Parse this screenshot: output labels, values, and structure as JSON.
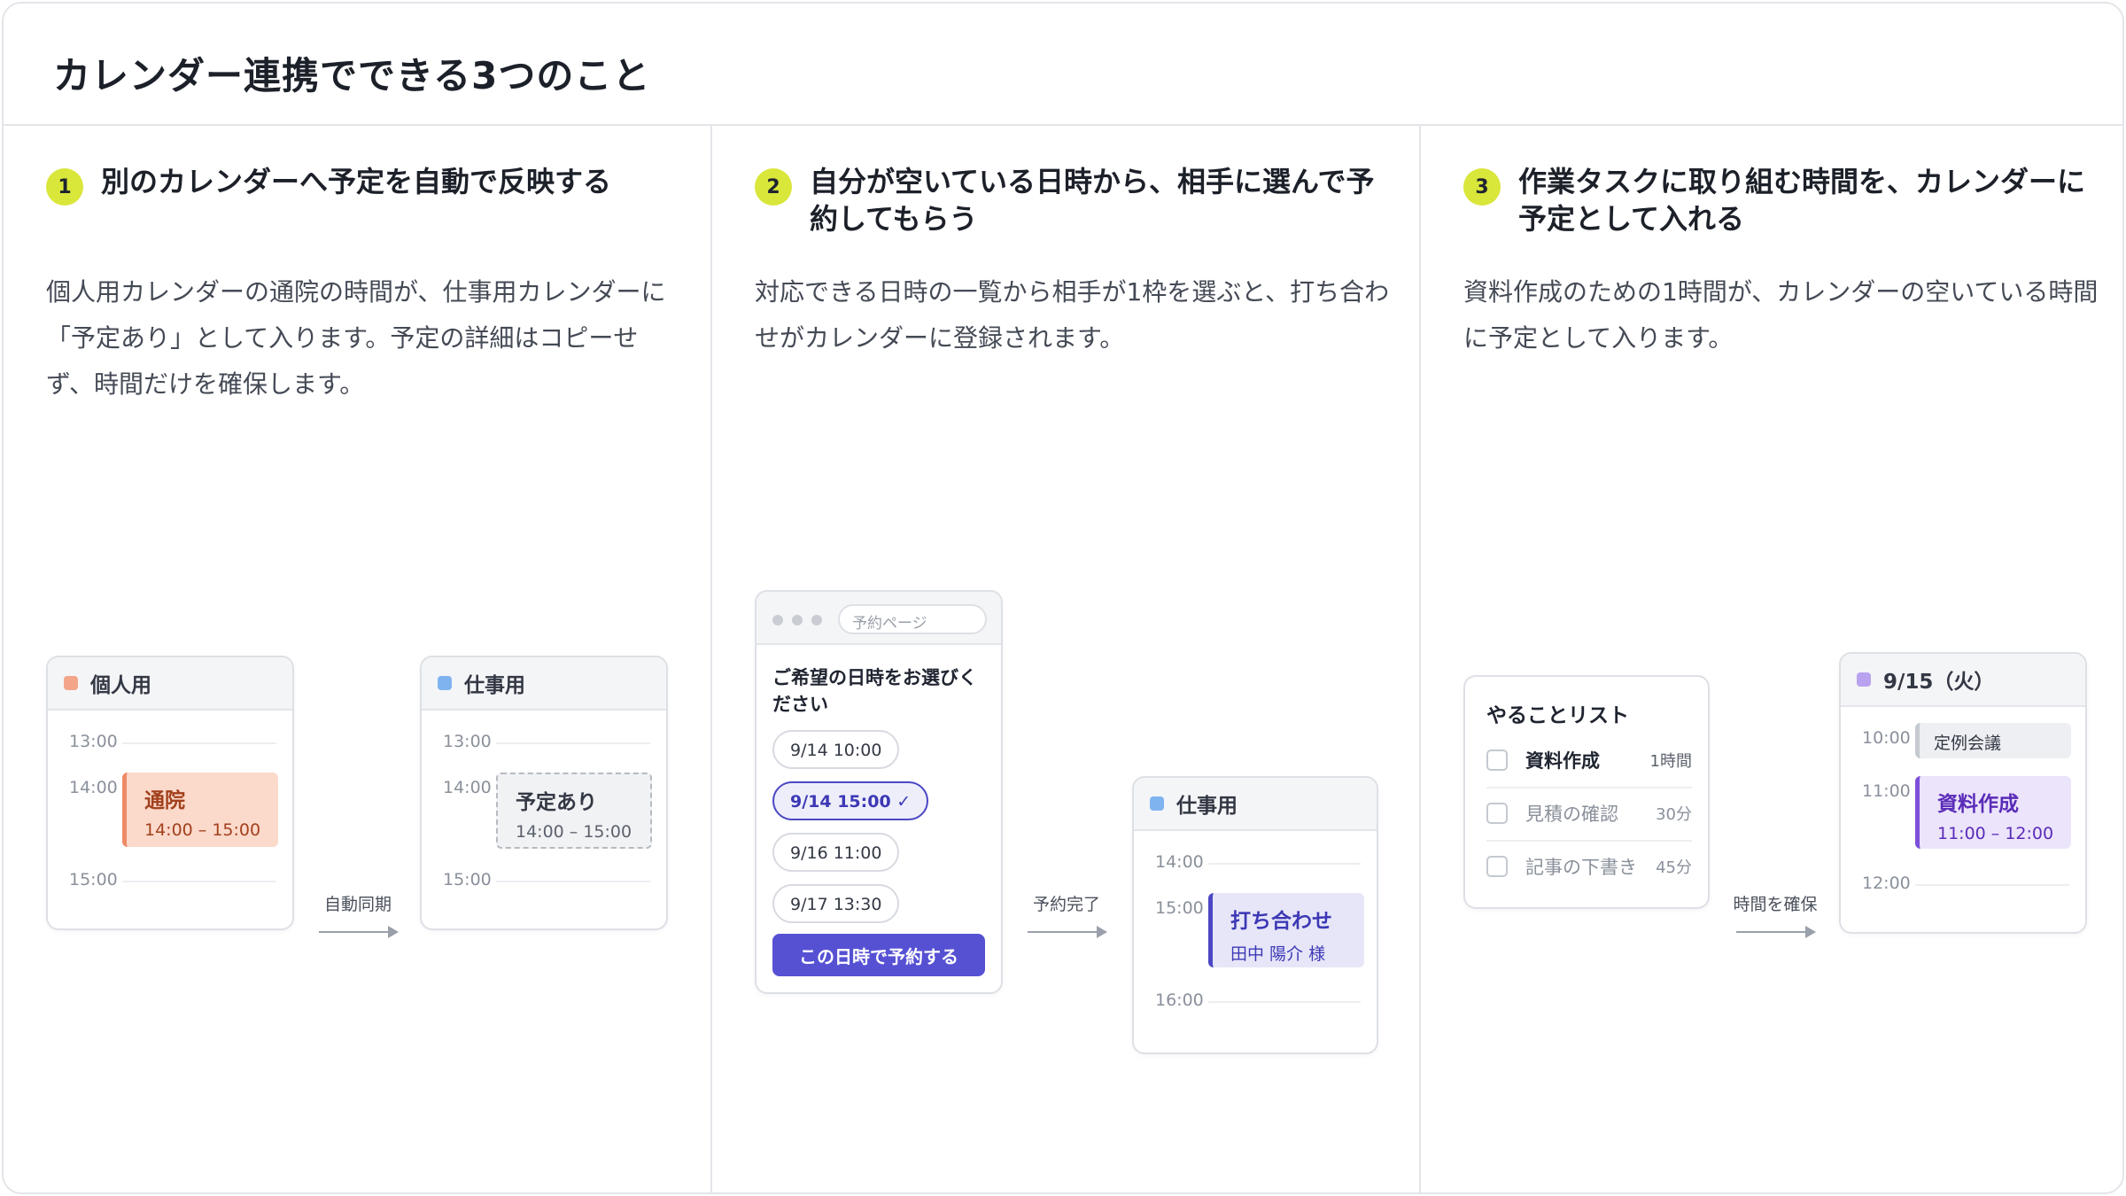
{
  "page": {
    "title": "カレンダー連携でできる3つのこと"
  },
  "colors": {
    "accent_badge": "#d9e63a",
    "personal": "#f3a58a",
    "work": "#7fb3f0",
    "primary": "#5651d3",
    "task": "#b9a3f0"
  },
  "col1": {
    "number": "1",
    "title": "別のカレンダーへ予定を自動で反映する",
    "desc": "個人用カレンダーの通院の時間が、仕事用カレンダーに「予定あり」として入ります。予定の詳細はコピーせず、時間だけを確保します。",
    "cal_a": {
      "title": "個人用",
      "times": [
        "13:00",
        "14:00",
        "15:00"
      ],
      "event_title": "通院",
      "event_time": "14:00 – 15:00"
    },
    "arrow_label": "自動同期",
    "cal_b": {
      "title": "仕事用",
      "times": [
        "13:00",
        "14:00",
        "15:00"
      ],
      "event_title": "予定あり",
      "event_time": "14:00 – 15:00"
    }
  },
  "col2": {
    "number": "2",
    "title": "自分が空いている日時から、相手に選んで予約してもらう",
    "desc": "対応できる日時の一覧から相手が1枠を選ぶと、打ち合わせがカレンダーに登録されます。",
    "booking": {
      "url": "予約ページ",
      "prompt": "ご希望の日時をお選びください",
      "slots": [
        "9/14 10:00",
        "9/14 15:00 ✓",
        "9/16 11:00",
        "9/17 13:30"
      ],
      "button": "この日時で予約する"
    },
    "arrow_label": "予約完了",
    "cal": {
      "title": "仕事用",
      "times": [
        "14:00",
        "15:00",
        "16:00"
      ],
      "event_title": "打ち合わせ",
      "event_sub": "田中 陽介 様"
    }
  },
  "col3": {
    "number": "3",
    "title": "作業タスクに取り組む時間を、カレンダーに予定として入れる",
    "desc": "資料作成のための1時間が、カレンダーの空いている時間に予定として入ります。",
    "todo": {
      "title": "やることリスト",
      "items": [
        {
          "label": "資料作成",
          "duration": "1時間"
        },
        {
          "label": "見積の確認",
          "duration": "30分"
        },
        {
          "label": "記事の下書き",
          "duration": "45分"
        }
      ]
    },
    "arrow_label": "時間を確保",
    "cal": {
      "title": "9/15（火）",
      "times": [
        "10:00",
        "11:00",
        "12:00"
      ],
      "existing": "定例会議",
      "event_title": "資料作成",
      "event_time": "11:00 – 12:00"
    }
  }
}
